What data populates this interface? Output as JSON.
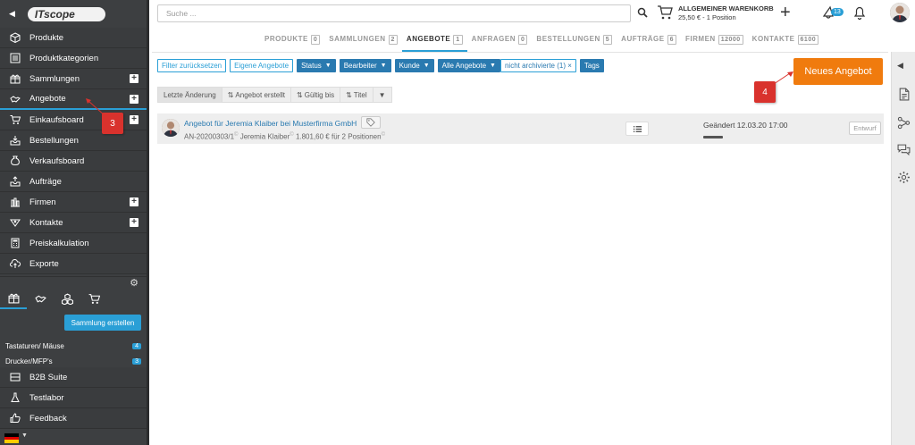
{
  "sidebar": {
    "logo_text": "ITscope",
    "items": [
      {
        "label": "Produkte",
        "icon": "cube-icon",
        "plus": false
      },
      {
        "label": "Produktkategorien",
        "icon": "list-icon",
        "plus": false
      },
      {
        "label": "Sammlungen",
        "icon": "gift-icon",
        "plus": true
      },
      {
        "label": "Angebote",
        "icon": "handshake-icon",
        "plus": true
      },
      {
        "label": "Einkaufsboard",
        "icon": "cart-icon",
        "plus": true
      },
      {
        "label": "Bestellungen",
        "icon": "inbox-icon",
        "plus": false
      },
      {
        "label": "Verkaufsboard",
        "icon": "moneybag-icon",
        "plus": false
      },
      {
        "label": "Aufträge",
        "icon": "tray-icon",
        "plus": false
      },
      {
        "label": "Firmen",
        "icon": "building-icon",
        "plus": true
      },
      {
        "label": "Kontakte",
        "icon": "contacts-icon",
        "plus": true
      },
      {
        "label": "Preiskalkulation",
        "icon": "calculator-icon",
        "plus": false
      },
      {
        "label": "Exporte",
        "icon": "cloud-upload-icon",
        "plus": false
      }
    ],
    "collection_button": "Sammlung erstellen",
    "collections": [
      {
        "name": "Tastaturen/ Mäuse",
        "count": "4"
      },
      {
        "name": "Drucker/MFP's",
        "count": "3"
      }
    ],
    "bottom_items": [
      {
        "label": "B2B Suite",
        "icon": "b2b-icon"
      },
      {
        "label": "Testlabor",
        "icon": "flask-icon"
      },
      {
        "label": "Feedback",
        "icon": "thumbs-up-icon"
      }
    ]
  },
  "topbar": {
    "search_placeholder": "Suche ...",
    "cart_title": "ALLGEMEINER WARENKORB",
    "cart_sub": "25,50 € - 1 Position",
    "notif_count": "13"
  },
  "tabs": [
    {
      "label": "PRODUKTE",
      "count": "0"
    },
    {
      "label": "SAMMLUNGEN",
      "count": "2"
    },
    {
      "label": "ANGEBOTE",
      "count": "1",
      "active": true
    },
    {
      "label": "ANFRAGEN",
      "count": "0"
    },
    {
      "label": "BESTELLUNGEN",
      "count": "5"
    },
    {
      "label": "AUFTRÄGE",
      "count": "6"
    },
    {
      "label": "FIRMEN",
      "count": "12000"
    },
    {
      "label": "KONTAKTE",
      "count": "6100"
    }
  ],
  "filters": {
    "reset": "Filter zurücksetzen",
    "own": "Eigene Angebote",
    "status": "Status",
    "editor": "Bearbeiter",
    "customer": "Kunde",
    "all_offers": "Alle Angebote",
    "not_archived": "nicht archivierte (1) ×",
    "tags": "Tags"
  },
  "new_offer_button": "Neues Angebot",
  "sort": {
    "last_change": "Letzte Änderung",
    "created": "Angebot erstellt",
    "valid": "Gültig bis",
    "title": "Titel"
  },
  "offer": {
    "title": "Angebot für Jeremia Klaiber bei Musterfirma GmbH",
    "number": "AN-20200303/1",
    "person": "Jeremia Klaiber",
    "summary": "1.801,60 € für 2 Positionen",
    "changed": "Geändert 12.03.20 17:00",
    "status": "Entwurf"
  },
  "annotations": [
    "3",
    "4"
  ],
  "colors": {
    "accent": "#2a9fd6",
    "orange": "#f07b0e",
    "annotation": "#d9322d",
    "sidebar": "#3d3f41"
  }
}
